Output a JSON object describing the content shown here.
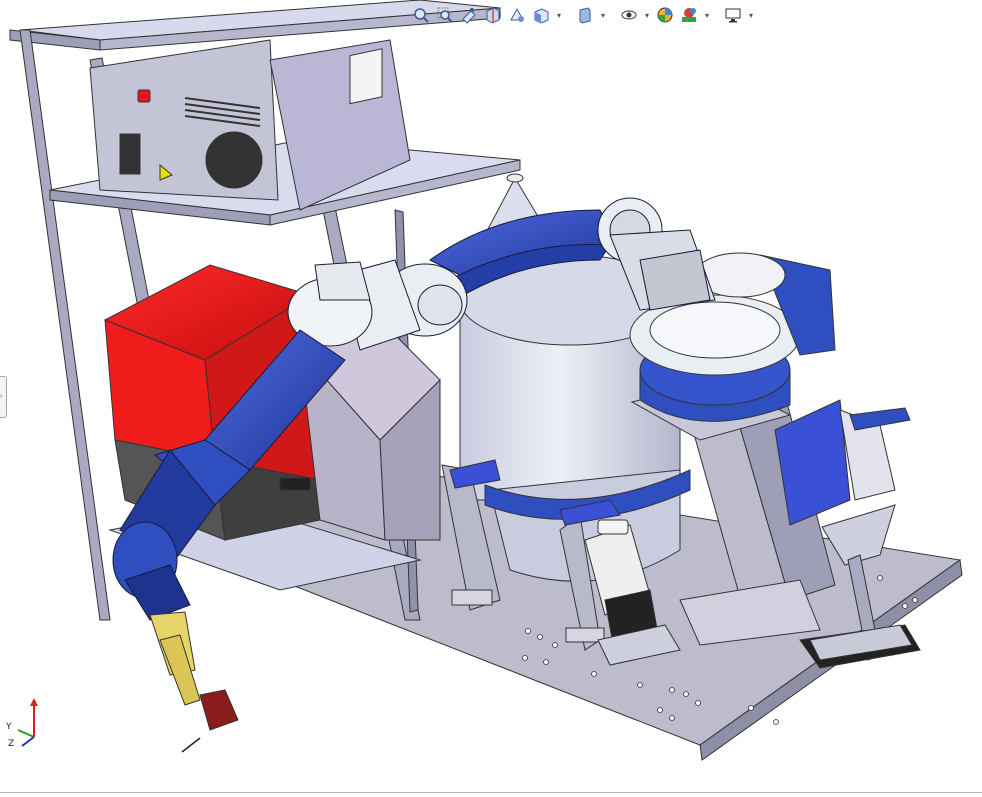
{
  "viewport": {
    "background": "#ffffff",
    "model_colors": {
      "robot_blue": "#2f4fc0",
      "robot_blue_dark": "#1e3390",
      "robot_white": "#e9eef3",
      "cabinet_red": "#f01c1c",
      "frame_steel": "#a9a9c2",
      "shelf": "#d9dcee",
      "base_plate": "#b8b8c8",
      "vessel": "#d6d8e6",
      "torch_yellow": "#e6d36a",
      "fixture_blue": "#3a50d6"
    }
  },
  "toolbar": {
    "items": [
      {
        "icon": "zoom-to-fit-icon"
      },
      {
        "icon": "zoom-to-area-icon"
      },
      {
        "icon": "previous-view-icon"
      },
      {
        "icon": "section-view-icon"
      },
      {
        "icon": "dynamic-annotation-icon"
      },
      {
        "icon": "view-orientation-icon",
        "dropdown": true
      },
      {
        "icon": "display-style-icon",
        "dropdown": true
      },
      {
        "icon": "hide-show-items-icon",
        "dropdown": true
      },
      {
        "icon": "edit-appearance-icon"
      },
      {
        "icon": "apply-scene-icon",
        "dropdown": true
      },
      {
        "icon": "view-settings-icon",
        "dropdown": true
      }
    ]
  },
  "triad": {
    "x_label": "",
    "y_label": "Y",
    "z_label": "Z",
    "x_color": "#d82020",
    "y_color": "#20a020",
    "z_color": "#2030d0"
  }
}
